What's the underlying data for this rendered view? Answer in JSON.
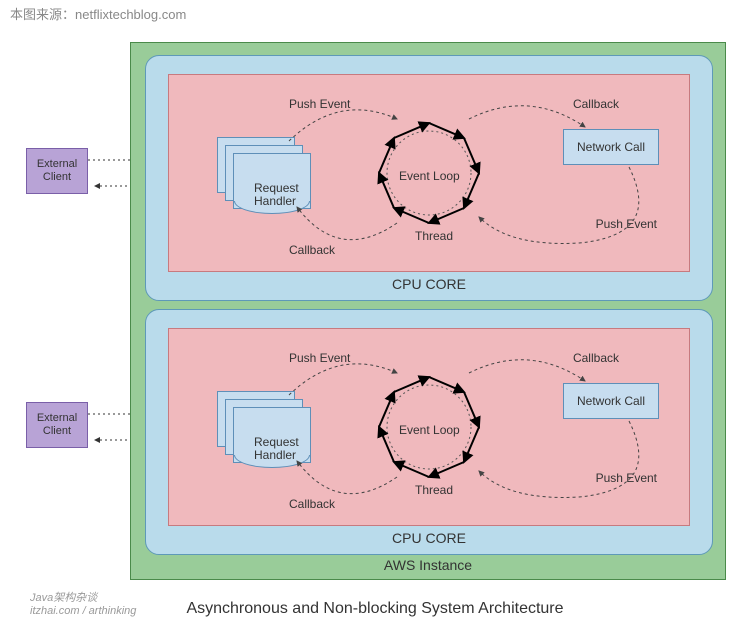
{
  "source": {
    "prefix": "本图来源：",
    "domain": "netflixtechblog.com"
  },
  "caption": "Asynchronous and Non-blocking System Architecture",
  "watermark": {
    "line1": "Java架构杂谈",
    "line2": "itzhai.com / arthinking"
  },
  "aws": {
    "label": "AWS Instance"
  },
  "cpu_core": {
    "label": "CPU CORE"
  },
  "pool": {
    "request_handler": "Request\nHandler",
    "network_call": "Network Call",
    "labels": {
      "push_event": "Push Event",
      "callback": "Callback",
      "event_loop": "Event Loop",
      "thread": "Thread"
    }
  },
  "external_client": "External\nClient"
}
